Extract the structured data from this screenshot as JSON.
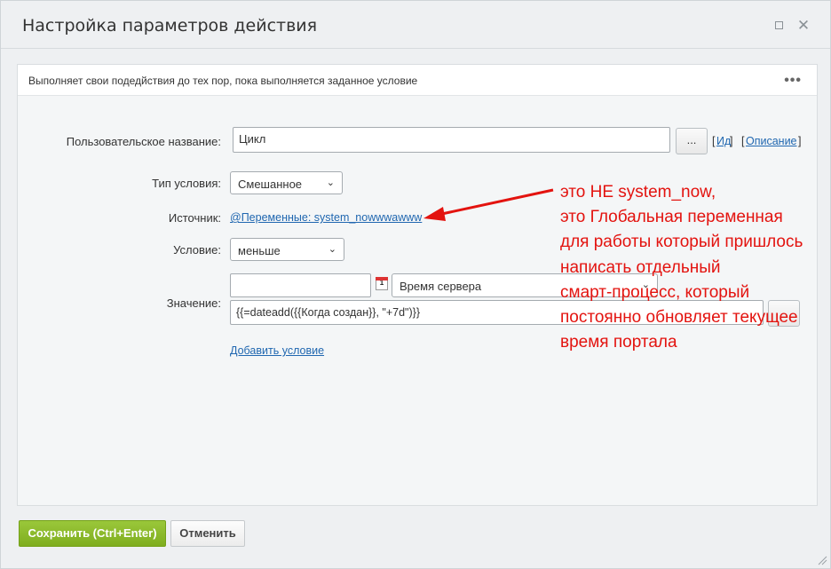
{
  "window": {
    "title": "Настройка параметров действия"
  },
  "panel": {
    "description": "Выполняет свои подедйствия до тех пор, пока выполняется заданное условие",
    "more_label": "•••"
  },
  "form": {
    "custom_name_label": "Пользовательское название:",
    "custom_name_value": "Цикл",
    "dots_label": "...",
    "id_link": "Ид",
    "description_link": "Описание",
    "condition_type_label": "Тип условия:",
    "condition_type_value": "Смешанное",
    "source_label": "Источник:",
    "source_link": "@Переменные: system_nowwwawww",
    "condition_label": "Условие:",
    "condition_value": "меньше",
    "value_label": "Значение:",
    "value_date_input": "",
    "calendar_day": "1",
    "timezone_value": "Время сервера",
    "value_expression": "{{=dateadd({{Когда создан}}, \"+7d\")}}",
    "add_condition_link": "Добавить условие"
  },
  "annotation": {
    "lines": [
      "это НЕ system_now,",
      "это Глобальная переменная",
      "для работы который пришлось",
      "написать отдельный",
      "смарт-процесс, который",
      "постоянно обновляет текущее",
      "время портала"
    ],
    "color": "#e3130f"
  },
  "footer": {
    "save_label": "Сохранить (Ctrl+Enter)",
    "cancel_label": "Отменить"
  },
  "colors": {
    "accent_green": "#8bb92a",
    "link_blue": "#2067b0"
  }
}
